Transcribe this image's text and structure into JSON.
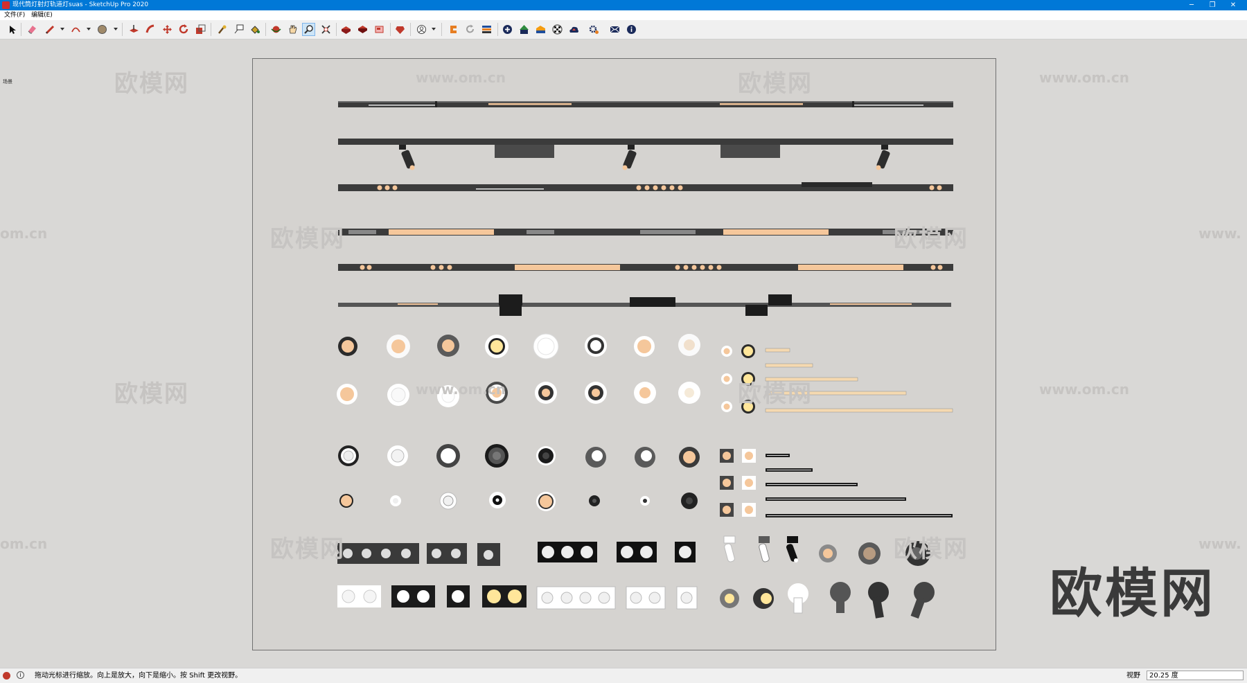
{
  "window": {
    "title": "现代筒灯射灯轨道灯suas - SketchUp Pro 2020",
    "minimize_glyph": "─",
    "restore_glyph": "❐",
    "close_glyph": "✕"
  },
  "menu": {
    "items": [
      {
        "label": "文件(F)"
      },
      {
        "label": "编辑(E)"
      }
    ]
  },
  "scene_label": "场景",
  "watermark": {
    "logo_text": "欧模网",
    "url_text": "www.om.cn",
    "url_fragment": "om.cn",
    "url_prefix": "www."
  },
  "big_logo": "欧模网",
  "status": {
    "message": "拖动光标进行缩放。向上是放大，向下是缩小。按 Shift 更改视野。",
    "view_label": "视野",
    "view_value": "20.25 度"
  },
  "toolbar": {
    "icons": [
      "select-icon",
      "eraser-icon",
      "pencil-icon",
      "arc-icon",
      "shape-icon",
      "pushpull-icon",
      "followme-icon",
      "move-icon",
      "rotate-icon",
      "scale-icon",
      "tape-icon",
      "text-icon",
      "paint-icon",
      "orbit-icon",
      "pan-icon",
      "zoom-icon",
      "zoom-extents-icon",
      "warehouse-icon",
      "extension-icon",
      "layout-icon",
      "ruby-icon",
      "account-icon",
      "plugin-icon",
      "refresh-icon",
      "export-icon",
      "add-icon",
      "tree-icon",
      "material-icon",
      "checker-icon",
      "upload-icon",
      "settings-icon",
      "mail-icon",
      "info-icon"
    ]
  },
  "colors": {
    "accent_blue": "#0078d7",
    "track_dark": "#3b3b3b",
    "light_peach": "#f5c79b",
    "bulb_yellow": "#ffe69a"
  }
}
